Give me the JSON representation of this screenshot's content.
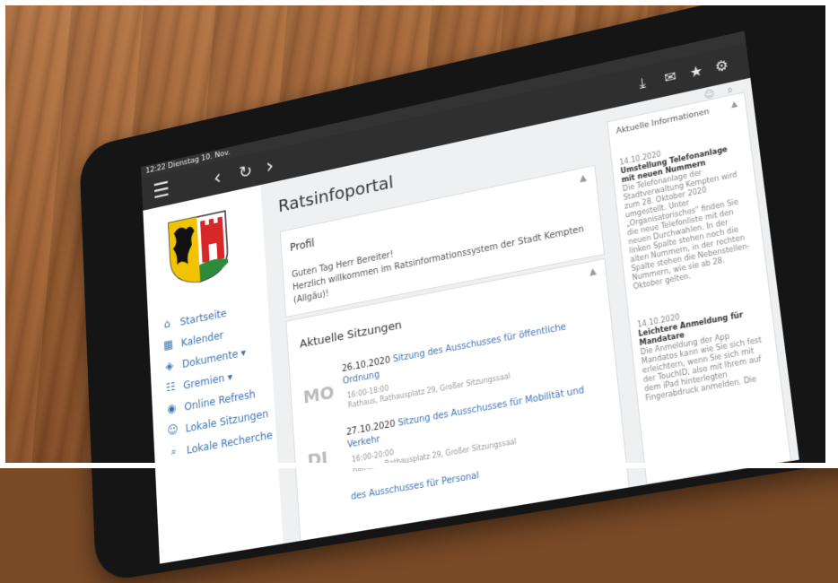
{
  "status": {
    "time": "12:22",
    "date": "Dienstag 10. Nov."
  },
  "toolbar": {
    "menu_icon": "hamburger-menu",
    "back_icon": "chevron-left",
    "reload_icon": "reload",
    "forward_icon": "chevron-right",
    "right_icons": [
      "download-icon",
      "chat-icon",
      "star-icon",
      "gear-icon"
    ]
  },
  "page": {
    "title": "Ratsinfoportal"
  },
  "nav": [
    {
      "label": "Startseite",
      "icon": "home-icon"
    },
    {
      "label": "Kalender",
      "icon": "calendar-icon"
    },
    {
      "label": "Dokumente ▾",
      "icon": "layers-icon"
    },
    {
      "label": "Gremien ▾",
      "icon": "org-chart-icon"
    },
    {
      "label": "Online Refresh",
      "icon": "eye-icon"
    },
    {
      "label": "Lokale Sitzungen",
      "icon": "user-icon"
    },
    {
      "label": "Lokale Recherche",
      "icon": "search-icon"
    }
  ],
  "profil": {
    "header": "Profil",
    "greeting": "Guten Tag Herr Bereiter!",
    "welcome": "Herzlich willkommen im Ratsinformationssystem der Stadt Kempten (Allgäu)!"
  },
  "sitzungen": {
    "header": "Aktuelle Sitzungen",
    "entries": [
      {
        "day": "MO",
        "date": "26.10.2020",
        "title": "Sitzung des Ausschusses für öffentliche Ordnung",
        "time": "16:00-18:00",
        "place": "Rathaus, Rathausplatz 29, Großer Sitzungssaal"
      },
      {
        "day": "DI",
        "date": "27.10.2020",
        "title": "Sitzung des Ausschusses für Mobilität und Verkehr",
        "time": "16:00-20:00",
        "place": "Rathaus, Rathausplatz 29, Großer Sitzungssaal"
      },
      {
        "day": "",
        "date": "",
        "title": "des Ausschusses für Personal",
        "time": "",
        "place": ""
      }
    ]
  },
  "info": {
    "header": "Aktuelle Informationen",
    "items": [
      {
        "date": "14.10.2020",
        "title": "Umstellung Telefonanlage mit neuen Nummern",
        "text": "Die Telefonanlage der Stadtverwaltung Kempten wird zum 28. Oktober 2020 umgestellt. Unter „Organisatorisches\" finden Sie die neue Telefonliste mit den neuen Durchwahlen. In der linken Spalte stehen noch die alten Nummern, in der rechten Spalte stehen die Nebenstellen-Nummern, wie sie ab 28. Oktober gelten."
      },
      {
        "date": "14.10.2020",
        "title": "Leichtere Anmeldung für Mandatare",
        "text": "Die Anmeldung der App Mandatos kann wie Sie sich fest erleichtern, wenn Sie sich mit der TouchID, also mit Ihrem auf dem iPad hinterlegten Fingerabdruck anmelden. Die"
      }
    ]
  },
  "colors": {
    "accent": "#3a73b4",
    "topbar": "#2f2f2f",
    "screen_bg": "#eef0f2"
  }
}
